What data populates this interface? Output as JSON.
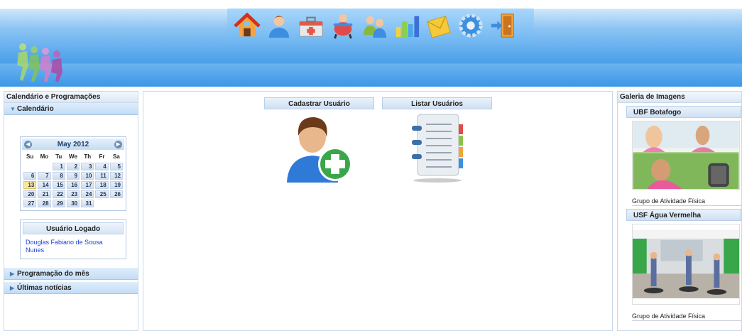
{
  "toolbar": {
    "icons": [
      "home-icon",
      "user-icon",
      "health-kit-icon",
      "activity-icon",
      "group-icon",
      "reports-chart-icon",
      "messages-icon",
      "settings-icon",
      "logout-icon"
    ]
  },
  "left": {
    "title": "Calendário e Programações",
    "calendar_heading": "Calendário",
    "month_label": "May 2012",
    "weekdays": [
      "Su",
      "Mo",
      "Tu",
      "We",
      "Th",
      "Fr",
      "Sa"
    ],
    "weeks": [
      [
        "",
        "",
        "1",
        "2",
        "3",
        "4",
        "5"
      ],
      [
        "6",
        "7",
        "8",
        "9",
        "10",
        "11",
        "12"
      ],
      [
        "13",
        "14",
        "15",
        "16",
        "17",
        "18",
        "19"
      ],
      [
        "20",
        "21",
        "22",
        "23",
        "24",
        "25",
        "26"
      ],
      [
        "27",
        "28",
        "29",
        "30",
        "31",
        "",
        ""
      ]
    ],
    "today": "13",
    "user_box_title": "Usuário Logado",
    "user_name": "Douglas Fabiano de Sousa Nunes",
    "programacao": "Programação do mês",
    "noticias": "Últimas notícias"
  },
  "center": {
    "register_label": "Cadastrar Usuário",
    "list_label": "Listar Usuários"
  },
  "right": {
    "title": "Galeria de Imagens",
    "gallery": [
      {
        "heading": "UBF Botafogo",
        "caption": "Grupo de Atividade Física"
      },
      {
        "heading": "USF Água Vermelha",
        "caption": "Grupo de Atividade Física"
      }
    ]
  },
  "colors": {
    "header_blue": "#4aa0ea",
    "link_blue": "#1a3fd6",
    "today_yellow": "#fbe69a"
  }
}
